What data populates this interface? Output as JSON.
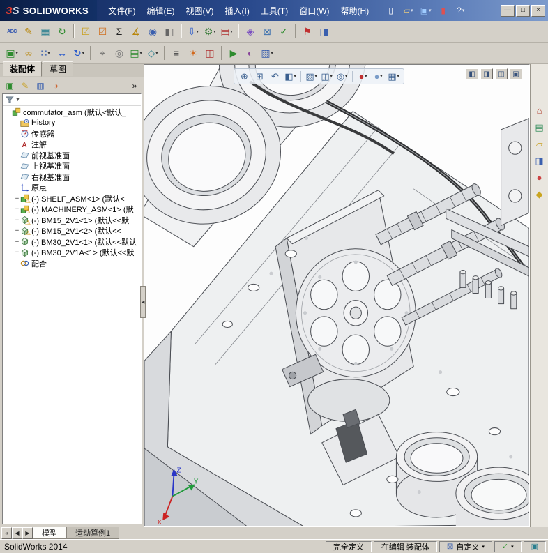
{
  "ui": {
    "dd_glyph": "▾",
    "chevron_glyph": "»",
    "filter_dd_glyph": "▼",
    "splitter_glyph": "◀"
  },
  "titlebar": {
    "logo_mark": "ЗS",
    "logo_text": "SOLIDWORKS",
    "menus": [
      {
        "label": "文件(F)"
      },
      {
        "label": "编辑(E)"
      },
      {
        "label": "视图(V)"
      },
      {
        "label": "插入(I)"
      },
      {
        "label": "工具(T)"
      },
      {
        "label": "窗口(W)"
      },
      {
        "label": "帮助(H)"
      }
    ],
    "quick": [
      {
        "name": "new-document-icon",
        "glyph": "▯",
        "fg": "#ffffff"
      },
      {
        "name": "open-document-icon",
        "glyph": "▱",
        "fg": "#ffd97a",
        "dd": true
      },
      {
        "name": "save-icon",
        "glyph": "▣",
        "fg": "#9ecbff",
        "dd": true
      },
      {
        "name": "toggle-display-icon",
        "glyph": "▮",
        "fg": "#e05050"
      },
      {
        "name": "help-icon",
        "glyph": "?",
        "fg": "#ffffff",
        "dd": true
      }
    ],
    "window_buttons": [
      {
        "name": "minimize-button",
        "glyph": "—"
      },
      {
        "name": "restore-button",
        "glyph": "□"
      },
      {
        "name": "close-button",
        "glyph": "×"
      }
    ]
  },
  "toolbars": {
    "main": [
      {
        "name": "spellcheck-icon",
        "glyph": "ABC",
        "fg": "#2a4fae",
        "small": true
      },
      {
        "name": "annotation-pen-icon",
        "glyph": "✎",
        "fg": "#b8860b"
      },
      {
        "name": "design-table-icon",
        "glyph": "▦",
        "fg": "#2a7f8f"
      },
      {
        "name": "rebuild-icon",
        "glyph": "↻",
        "fg": "#2e8b2e"
      },
      {
        "sep": true
      },
      {
        "name": "selection-filter-icon",
        "glyph": "☑",
        "fg": "#c8a020"
      },
      {
        "name": "verification-icon",
        "glyph": "☑",
        "fg": "#d07020"
      },
      {
        "name": "equations-icon",
        "glyph": "Σ",
        "fg": "#222222"
      },
      {
        "name": "measure-icon",
        "glyph": "∡",
        "fg": "#b8860b"
      },
      {
        "name": "mass-properties-icon",
        "glyph": "◉",
        "fg": "#3a5fae"
      },
      {
        "name": "section-properties-icon",
        "glyph": "◧",
        "fg": "#666666"
      },
      {
        "sep": true
      },
      {
        "name": "import-icon",
        "glyph": "⇩",
        "fg": "#2255cc",
        "dd": true
      },
      {
        "name": "options-icon",
        "glyph": "⚙",
        "fg": "#3f7f3f",
        "dd": true
      },
      {
        "name": "design-checker-icon",
        "glyph": "▤",
        "fg": "#b03030",
        "dd": true
      },
      {
        "sep": true
      },
      {
        "name": "interference-icon",
        "glyph": "◈",
        "fg": "#7a4fc0"
      },
      {
        "name": "deviation-analysis-icon",
        "glyph": "⊠",
        "fg": "#3a6fae"
      },
      {
        "name": "accept-icon",
        "glyph": "✓",
        "fg": "#2e8b2e"
      },
      {
        "sep": true
      },
      {
        "name": "flag-icon",
        "glyph": "⚑",
        "fg": "#c03030"
      },
      {
        "name": "appearance-palette-icon",
        "glyph": "◨",
        "fg": "#3a5fae"
      }
    ],
    "assembly": [
      {
        "name": "insert-component-icon",
        "glyph": "▣",
        "fg": "#2e8b2e",
        "dd": true
      },
      {
        "name": "mate-icon",
        "glyph": "∞",
        "fg": "#b8860b"
      },
      {
        "name": "component-pattern-icon",
        "glyph": "∷",
        "fg": "#3a5fae",
        "dd": true
      },
      {
        "name": "move-component-icon",
        "glyph": "↔",
        "fg": "#2255cc"
      },
      {
        "name": "rotate-component-icon",
        "glyph": "↻",
        "fg": "#2255cc",
        "dd": true
      },
      {
        "sep": true
      },
      {
        "name": "smart-fasteners-icon",
        "glyph": "⌖",
        "fg": "#555555"
      },
      {
        "name": "show-hidden-components-icon",
        "glyph": "◎",
        "fg": "#777777"
      },
      {
        "name": "assembly-features-icon",
        "glyph": "▤",
        "fg": "#2e8b2e",
        "dd": true
      },
      {
        "name": "reference-geometry-icon",
        "glyph": "◇",
        "fg": "#2a7f8f",
        "dd": true
      },
      {
        "sep": true
      },
      {
        "name": "bill-of-materials-icon",
        "glyph": "≡",
        "fg": "#555555"
      },
      {
        "name": "exploded-view-icon",
        "glyph": "✶",
        "fg": "#d2691e"
      },
      {
        "name": "interference-detection-icon",
        "glyph": "◫",
        "fg": "#b03030"
      },
      {
        "sep": true
      },
      {
        "name": "motion-study-icon",
        "glyph": "▶",
        "fg": "#2e8b2e"
      },
      {
        "name": "render-icon",
        "glyph": "◐",
        "fg": "#884499"
      },
      {
        "name": "drawing-icon",
        "glyph": "▧",
        "fg": "#3a5fae",
        "dd": true
      }
    ]
  },
  "panel": {
    "tabs": [
      {
        "label": "装配体",
        "active": true
      },
      {
        "label": "草图",
        "active": false
      }
    ],
    "toolbar": [
      {
        "name": "featuremanager-tree-icon",
        "glyph": "▣",
        "fg": "#2e8b2e"
      },
      {
        "name": "property-manager-icon",
        "glyph": "✎",
        "fg": "#c8a020"
      },
      {
        "name": "configuration-manager-icon",
        "glyph": "▥",
        "fg": "#3a5fae"
      },
      {
        "name": "display-manager-icon",
        "glyph": "◑",
        "fg": "#cc6633"
      }
    ],
    "warning_glyph": "⚠",
    "tree": [
      {
        "icon": "assembly",
        "label": "commutator_asm (默认<默认_",
        "lvl": 0,
        "expand": "",
        "warn": false
      },
      {
        "icon": "history",
        "label": "History",
        "lvl": 1,
        "expand": "",
        "warn": false
      },
      {
        "icon": "sensor",
        "label": "传感器",
        "lvl": 1,
        "expand": "",
        "warn": false
      },
      {
        "icon": "note",
        "label": "注解",
        "lvl": 1,
        "expand": "",
        "warn": false
      },
      {
        "icon": "plane",
        "label": "前视基准面",
        "lvl": 1,
        "expand": "",
        "warn": false
      },
      {
        "icon": "plane",
        "label": "上视基准面",
        "lvl": 1,
        "expand": "",
        "warn": false
      },
      {
        "icon": "plane",
        "label": "右视基准面",
        "lvl": 1,
        "expand": "",
        "warn": false
      },
      {
        "icon": "origin",
        "label": "原点",
        "lvl": 1,
        "expand": "",
        "warn": false
      },
      {
        "icon": "assembly",
        "label": "(-) SHELF_ASM<1> (默认<",
        "lvl": 1,
        "expand": "+",
        "warn": true
      },
      {
        "icon": "assembly",
        "label": "(-) MACHINERY_ASM<1> (默",
        "lvl": 1,
        "expand": "+",
        "warn": true
      },
      {
        "icon": "part",
        "label": "(-) BM15_2V1<1> (默认<<默",
        "lvl": 1,
        "expand": "+",
        "warn": true
      },
      {
        "icon": "part",
        "label": "(-) BM15_2V1<2> (默认<<",
        "lvl": 1,
        "expand": "+",
        "warn": true
      },
      {
        "icon": "part",
        "label": "(-) BM30_2V1<1> (默认<<默认",
        "lvl": 1,
        "expand": "+",
        "warn": false
      },
      {
        "icon": "part",
        "label": "(-) BM30_2V1A<1> (默认<<默",
        "lvl": 1,
        "expand": "+",
        "warn": false
      },
      {
        "icon": "mates",
        "label": "配合",
        "lvl": 1,
        "expand": "",
        "warn": false
      }
    ]
  },
  "hud": {
    "items": [
      {
        "name": "zoom-fit-icon",
        "glyph": "⊕",
        "fg": "#3a5f8f"
      },
      {
        "name": "zoom-area-icon",
        "glyph": "⊞",
        "fg": "#3a5f8f"
      },
      {
        "name": "previous-view-icon",
        "glyph": "↶",
        "fg": "#3a5f8f"
      },
      {
        "name": "section-view-icon",
        "glyph": "◧",
        "fg": "#3a5f8f",
        "dd": true
      },
      {
        "sep": true
      },
      {
        "name": "view-orientation-icon",
        "glyph": "▧",
        "fg": "#3a5f8f",
        "dd": true
      },
      {
        "name": "display-style-icon",
        "glyph": "◫",
        "fg": "#3a5f8f",
        "dd": true
      },
      {
        "name": "hide-show-items-icon",
        "glyph": "◎",
        "fg": "#3a5f8f",
        "dd": true
      },
      {
        "sep": true
      },
      {
        "name": "edit-appearance-icon",
        "glyph": "●",
        "fg": "#c03030",
        "dd": true
      },
      {
        "name": "apply-scene-icon",
        "glyph": "●",
        "fg": "#7a9cc8",
        "dd": true
      },
      {
        "name": "view-settings-icon",
        "glyph": "▦",
        "fg": "#3a5f8f",
        "dd": true
      }
    ]
  },
  "viewport": {
    "doc_buttons": [
      {
        "name": "pane-left-button",
        "glyph": "◧"
      },
      {
        "name": "pane-right-button",
        "glyph": "◨"
      },
      {
        "name": "pane-split-button",
        "glyph": "◫"
      },
      {
        "name": "pane-single-button",
        "glyph": "▣"
      }
    ],
    "triad": {
      "x": "X",
      "y": "Y",
      "z": "Z"
    }
  },
  "taskpane": {
    "items": [
      {
        "name": "task-home-icon",
        "glyph": "⌂",
        "fg": "#b04030"
      },
      {
        "name": "design-library-icon",
        "glyph": "▤",
        "fg": "#2e8b57"
      },
      {
        "name": "file-explorer-icon",
        "glyph": "▱",
        "fg": "#c8a020"
      },
      {
        "name": "view-palette-icon",
        "glyph": "◨",
        "fg": "#3a5fae"
      },
      {
        "name": "appearances-icon",
        "glyph": "●",
        "fg": "#cc4444"
      },
      {
        "name": "custom-properties-icon",
        "glyph": "◆",
        "fg": "#caa520"
      }
    ]
  },
  "tabbar": {
    "nav": [
      {
        "name": "tab-scroll-first-button",
        "glyph": "«"
      },
      {
        "name": "tab-scroll-left-button",
        "glyph": "◀"
      },
      {
        "name": "tab-scroll-right-button",
        "glyph": "▶"
      }
    ],
    "tabs": [
      {
        "label": "模型",
        "active": true
      },
      {
        "label": "运动算例1",
        "active": false
      }
    ]
  },
  "statusbar": {
    "left": "SolidWorks 2014",
    "doc_status": "完全定义",
    "edit_status": "在编辑 装配体",
    "custom_label": "自定义",
    "check_glyph": "✓",
    "indicator_glyph": "▣"
  }
}
